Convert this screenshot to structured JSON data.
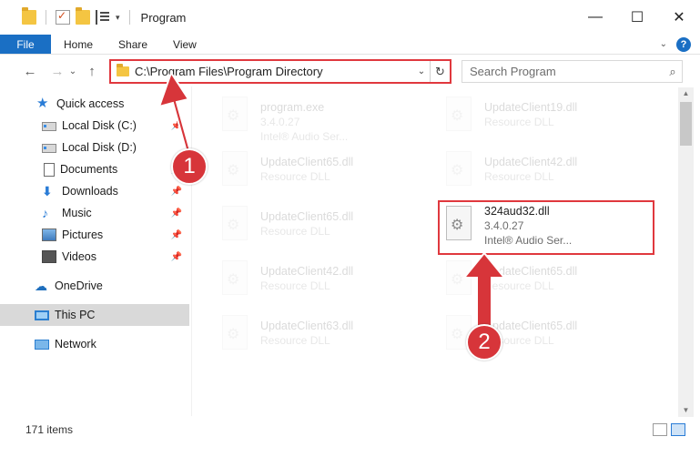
{
  "window": {
    "title": "Program",
    "minimize": "—",
    "maximize": "☐",
    "close": "✕"
  },
  "ribbon": {
    "file": "File",
    "tabs": [
      "Home",
      "Share",
      "View"
    ],
    "expand": "⌄",
    "help": "?"
  },
  "nav": {
    "back": "←",
    "forward": "→",
    "history": "⌄",
    "up": "↑",
    "address": "C:\\Program Files\\Program Directory",
    "address_dropdown": "⌄",
    "refresh": "↻",
    "search_placeholder": "Search Program",
    "search_icon": "⌕"
  },
  "sidebar": {
    "items": [
      {
        "label": "Quick access",
        "icon": "star-icon",
        "pinned": false
      },
      {
        "label": "Local Disk (C:)",
        "icon": "drive-icon",
        "pinned": true
      },
      {
        "label": "Local Disk (D:)",
        "icon": "drive-icon",
        "pinned": false
      },
      {
        "label": "Documents",
        "icon": "document-icon",
        "pinned": true
      },
      {
        "label": "Downloads",
        "icon": "download-icon",
        "pinned": true
      },
      {
        "label": "Music",
        "icon": "music-icon",
        "pinned": true
      },
      {
        "label": "Pictures",
        "icon": "pictures-icon",
        "pinned": true
      },
      {
        "label": "Videos",
        "icon": "videos-icon",
        "pinned": true
      },
      {
        "label": "OneDrive",
        "icon": "cloud-icon",
        "pinned": false
      },
      {
        "label": "This PC",
        "icon": "computer-icon",
        "pinned": false,
        "selected": true
      },
      {
        "label": "Network",
        "icon": "network-icon",
        "pinned": false
      }
    ],
    "pin_glyph": "📌"
  },
  "files": [
    {
      "name": "program.exe",
      "sub1": "3.4.0.27",
      "sub2": "Intel® Audio Ser..."
    },
    {
      "name": "UpdateClient19.dll",
      "sub1": "Resource DLL"
    },
    {
      "name": "UpdateClient65.dll",
      "sub1": "Resource DLL"
    },
    {
      "name": "UpdateClient42.dll",
      "sub1": "Resource DLL"
    },
    {
      "name": "UpdateClient65.dll",
      "sub1": "Resource DLL"
    },
    {
      "name": "324aud32.dll",
      "sub1": "3.4.0.27",
      "sub2": "Intel® Audio Ser..."
    },
    {
      "name": "UpdateClient42.dll",
      "sub1": "Resource DLL"
    },
    {
      "name": "UpdateClient65.dll",
      "sub1": "Resource DLL"
    },
    {
      "name": "UpdateClient63.dll",
      "sub1": "Resource DLL"
    },
    {
      "name": "UpdateClient65.dll",
      "sub1": "Resource DLL"
    }
  ],
  "status": {
    "item_count": "171 items"
  },
  "annotations": {
    "step1": "1",
    "step2": "2",
    "accent": "#e0383e"
  }
}
